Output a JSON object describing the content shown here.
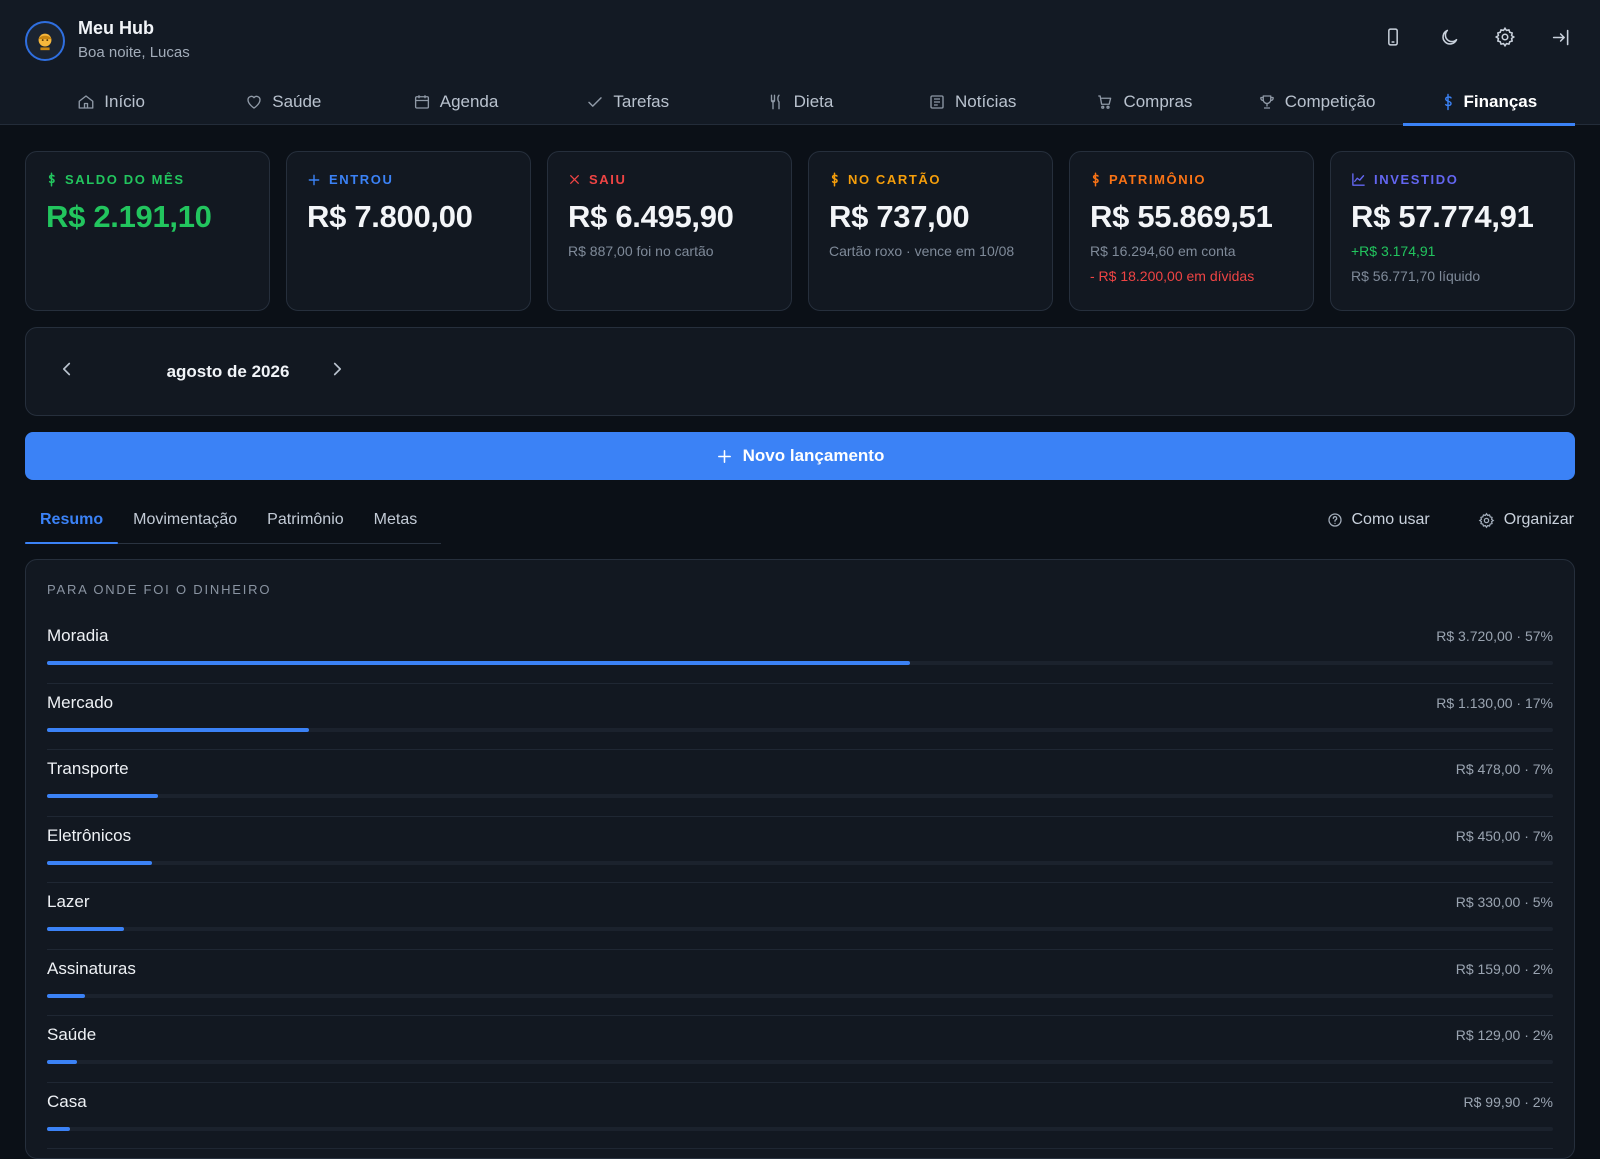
{
  "header": {
    "title": "Meu Hub",
    "greeting": "Boa noite, Lucas",
    "actions": [
      {
        "icon": "phone-icon"
      },
      {
        "icon": "moon-icon"
      },
      {
        "icon": "gear-icon"
      },
      {
        "icon": "logout-icon"
      }
    ]
  },
  "nav": {
    "tabs": [
      {
        "label": "Início",
        "icon": "home-icon"
      },
      {
        "label": "Saúde",
        "icon": "heart-icon"
      },
      {
        "label": "Agenda",
        "icon": "calendar-icon"
      },
      {
        "label": "Tarefas",
        "icon": "check-icon"
      },
      {
        "label": "Dieta",
        "icon": "utensils-icon"
      },
      {
        "label": "Notícias",
        "icon": "newspaper-icon"
      },
      {
        "label": "Compras",
        "icon": "cart-icon"
      },
      {
        "label": "Competição",
        "icon": "trophy-icon"
      },
      {
        "label": "Finanças",
        "icon": "dollar-icon",
        "active": true
      }
    ]
  },
  "cards": [
    {
      "label": "SALDO DO MÊS",
      "icon": "dollar-icon",
      "color": "#22c55e",
      "value": "R$ 2.191,10",
      "value_color": "#22c55e",
      "subs": []
    },
    {
      "label": "ENTROU",
      "icon": "plus-icon",
      "color": "#3b82f6",
      "value": "R$ 7.800,00",
      "subs": []
    },
    {
      "label": "SAIU",
      "icon": "close-icon",
      "color": "#ef4444",
      "value": "R$ 6.495,90",
      "subs": [
        {
          "text": "R$ 887,00 foi no cartão"
        }
      ]
    },
    {
      "label": "NO CARTÃO",
      "icon": "dollar-icon",
      "color": "#f59e0b",
      "value": "R$ 737,00",
      "subs": [
        {
          "text": "Cartão roxo · vence em 10/08"
        }
      ]
    },
    {
      "label": "PATRIMÔNIO",
      "icon": "dollar-icon",
      "color": "#f97316",
      "value": "R$ 55.869,51",
      "subs": [
        {
          "text": "R$ 16.294,60 em conta"
        },
        {
          "text": "- R$ 18.200,00 em dívidas",
          "color": "#ef4444"
        }
      ]
    },
    {
      "label": "INVESTIDO",
      "icon": "chart-line-icon",
      "color": "#6366f1",
      "value": "R$ 57.774,91",
      "subs": [
        {
          "text": "+R$ 3.174,91",
          "color": "#22c55e"
        },
        {
          "text": "R$ 56.771,70 líquido"
        }
      ]
    }
  ],
  "month": {
    "label": "agosto de 2026"
  },
  "new_entry": {
    "label": "Novo lançamento"
  },
  "subtabs": [
    {
      "label": "Resumo",
      "active": true
    },
    {
      "label": "Movimentação"
    },
    {
      "label": "Patrimônio"
    },
    {
      "label": "Metas"
    }
  ],
  "sub_actions": {
    "help": "Como usar",
    "organize": "Organizar"
  },
  "breakdown": {
    "title": "PARA ONDE FOI O DINHEIRO",
    "items": [
      {
        "name": "Moradia",
        "value": "R$ 3.720,00 · 57%",
        "fraction": 0.573
      },
      {
        "name": "Mercado",
        "value": "R$ 1.130,00 · 17%",
        "fraction": 0.174
      },
      {
        "name": "Transporte",
        "value": "R$ 478,00 · 7%",
        "fraction": 0.074
      },
      {
        "name": "Eletrônicos",
        "value": "R$ 450,00 · 7%",
        "fraction": 0.07
      },
      {
        "name": "Lazer",
        "value": "R$ 330,00 · 5%",
        "fraction": 0.051
      },
      {
        "name": "Assinaturas",
        "value": "R$ 159,00 · 2%",
        "fraction": 0.025
      },
      {
        "name": "Saúde",
        "value": "R$ 129,00 · 2%",
        "fraction": 0.02
      },
      {
        "name": "Casa",
        "value": "R$ 99,90 · 2%",
        "fraction": 0.015
      }
    ]
  }
}
